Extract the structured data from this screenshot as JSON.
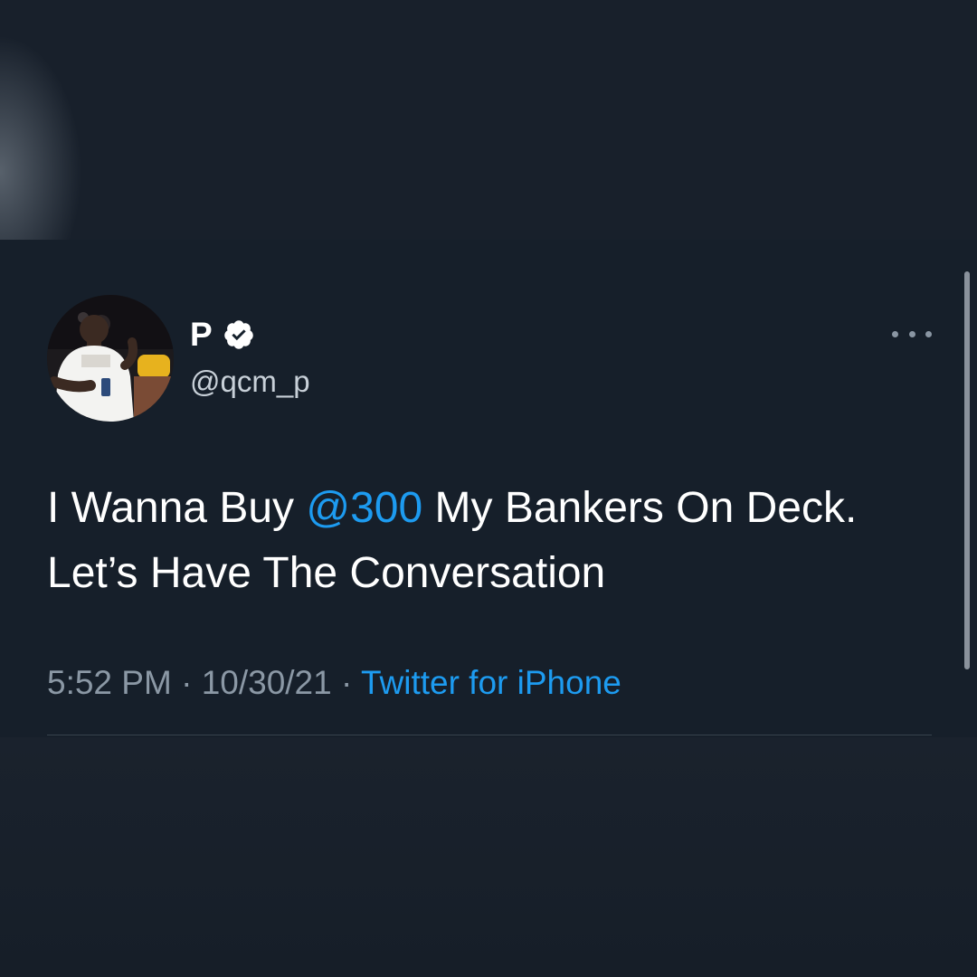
{
  "tweet": {
    "display_name": "P",
    "handle": "@qcm_p",
    "text_before": "I Wanna Buy ",
    "mention": "@300",
    "text_after": " My Bankers On Deck. Let’s Have The Conversation",
    "time": "5:52 PM",
    "separator_1": " · ",
    "date": "10/30/21",
    "separator_2": " · ",
    "source": "Twitter for iPhone"
  },
  "icons": {
    "verified": "verified-badge-icon",
    "more": "more-options-icon"
  },
  "colors": {
    "background": "#161f2a",
    "link": "#1d9bf0",
    "secondary_text": "#8b98a5"
  }
}
